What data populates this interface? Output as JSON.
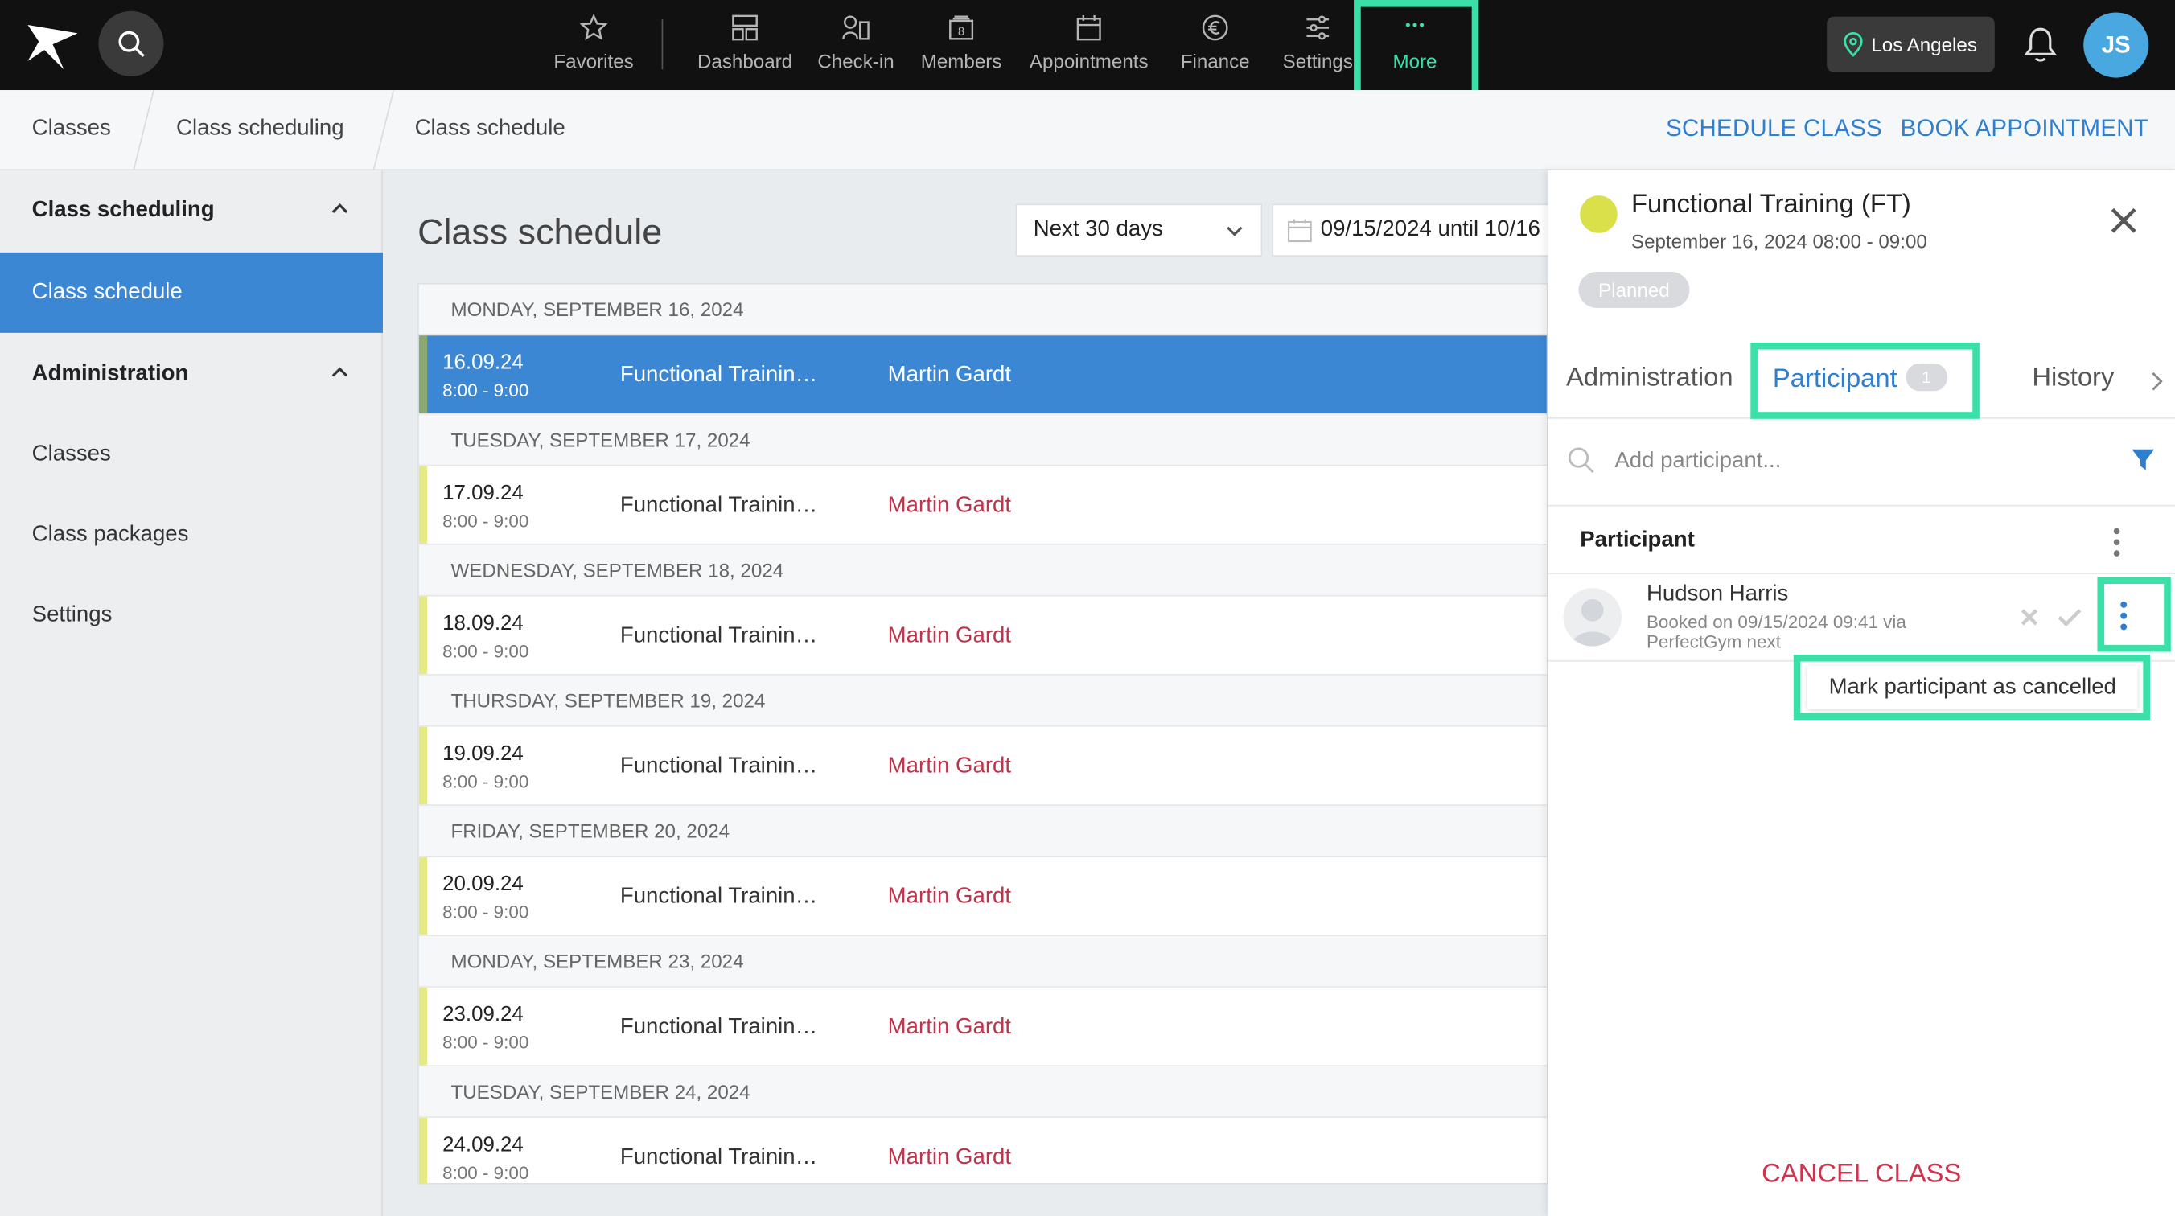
{
  "nav": {
    "favorites": "Favorites",
    "dashboard": "Dashboard",
    "checkin": "Check-in",
    "members": "Members",
    "appointments": "Appointments",
    "finance": "Finance",
    "settings": "Settings",
    "more": "More",
    "location": "Los Angeles",
    "user_initials": "JS"
  },
  "breadcrumb": {
    "items": [
      "Classes",
      "Class scheduling",
      "Class schedule"
    ],
    "schedule_class": "SCHEDULE CLASS",
    "book_appointment": "BOOK APPOINTMENT"
  },
  "sidebar": {
    "group1": "Class scheduling",
    "group1_items": [
      "Class schedule"
    ],
    "group2": "Administration",
    "group2_items": [
      "Classes",
      "Class packages",
      "Settings"
    ]
  },
  "main": {
    "title": "Class schedule",
    "range_select": "Next 30 days",
    "date_range": "09/15/2024 until 10/16",
    "days": [
      {
        "header": "Monday, September 16, 2024",
        "date": "16.09.24",
        "time": "8:00  -  9:00",
        "class": "Functional Trainin…",
        "trainer": "Martin Gardt",
        "selected": true
      },
      {
        "header": "Tuesday, September 17, 2024",
        "date": "17.09.24",
        "time": "8:00  -  9:00",
        "class": "Functional Trainin…",
        "trainer": "Martin Gardt"
      },
      {
        "header": "Wednesday, September 18, 2024",
        "date": "18.09.24",
        "time": "8:00  -  9:00",
        "class": "Functional Trainin…",
        "trainer": "Martin Gardt"
      },
      {
        "header": "Thursday, September 19, 2024",
        "date": "19.09.24",
        "time": "8:00  -  9:00",
        "class": "Functional Trainin…",
        "trainer": "Martin Gardt"
      },
      {
        "header": "Friday, September 20, 2024",
        "date": "20.09.24",
        "time": "8:00  -  9:00",
        "class": "Functional Trainin…",
        "trainer": "Martin Gardt"
      },
      {
        "header": "Monday, September 23, 2024",
        "date": "23.09.24",
        "time": "8:00  -  9:00",
        "class": "Functional Trainin…",
        "trainer": "Martin Gardt"
      },
      {
        "header": "Tuesday, September 24, 2024",
        "date": "24.09.24",
        "time": "8:00  -  9:00",
        "class": "Functional Trainin…",
        "trainer": "Martin Gardt"
      }
    ]
  },
  "panel": {
    "title": "Functional Training (FT)",
    "subtitle": "September 16, 2024 08:00 - 09:00",
    "status": "Planned",
    "tabs": {
      "administration": "Administration",
      "participant": "Participant",
      "participant_count": "1",
      "history": "History"
    },
    "add_placeholder": "Add participant...",
    "section_title": "Participant",
    "participant": {
      "name": "Hudson Harris",
      "meta": "Booked on 09/15/2024 09:41 via PerfectGym next"
    },
    "menu_item": "Mark participant as cancelled",
    "cancel_class": "CANCEL CLASS"
  },
  "colors": {
    "accent": "#3b87d4",
    "highlight": "#3be0a8",
    "trainer": "#c0334a",
    "class_dot": "#d9e04a"
  }
}
